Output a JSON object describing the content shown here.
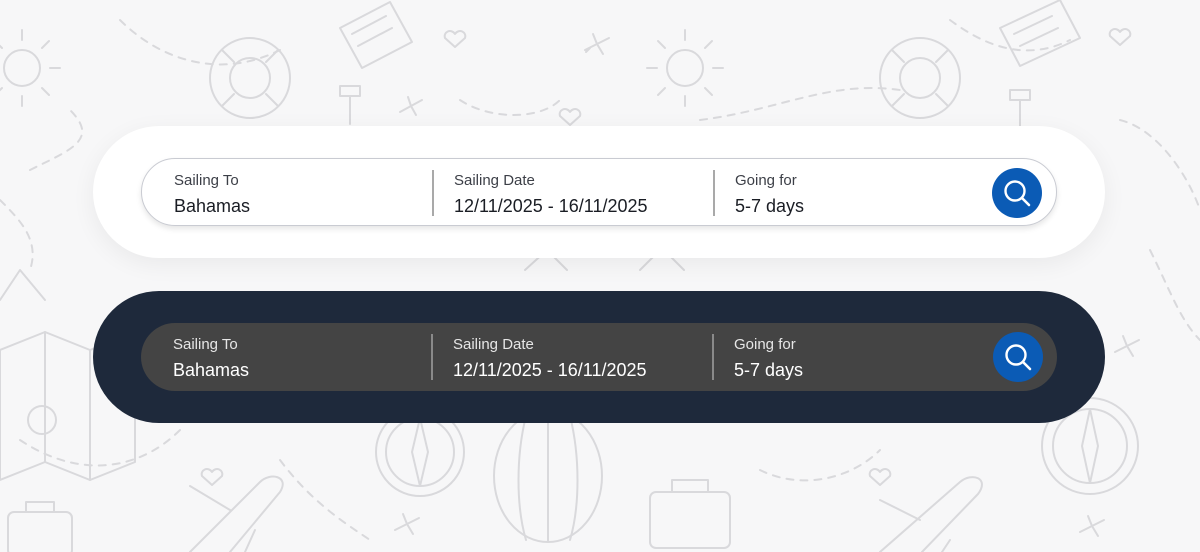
{
  "colors": {
    "background": "#f7f7f8",
    "light_panel": "#ffffff",
    "dark_panel": "#1e293b",
    "dark_bar": "#444444",
    "search_button": "#0b5bb5"
  },
  "widgets": [
    {
      "theme": "light",
      "fields": [
        {
          "label": "Sailing To",
          "value": "Bahamas"
        },
        {
          "label": "Sailing Date",
          "value": "12/11/2025 - 16/11/2025"
        },
        {
          "label": "Going for",
          "value": "5-7 days"
        }
      ],
      "search_icon": "search-icon"
    },
    {
      "theme": "dark",
      "fields": [
        {
          "label": "Sailing To",
          "value": "Bahamas"
        },
        {
          "label": "Sailing Date",
          "value": "12/11/2025 - 16/11/2025"
        },
        {
          "label": "Going for",
          "value": "5-7 days"
        }
      ],
      "search_icon": "search-icon"
    }
  ]
}
